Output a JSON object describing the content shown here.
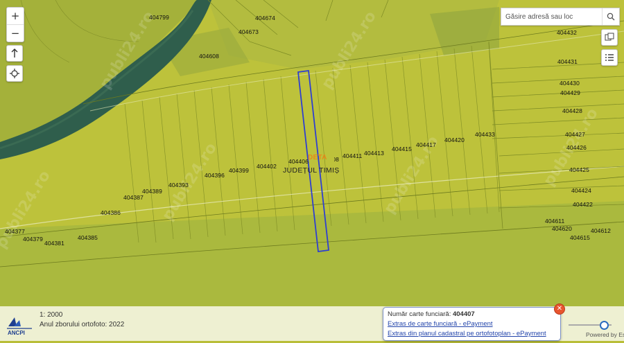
{
  "search": {
    "placeholder": "Găsire adresă sau loc"
  },
  "zoom": {
    "in_label": "+",
    "out_label": "−"
  },
  "scale": {
    "text": "1: 2000",
    "orthophoto_year": "Anul zborului ortofoto: 2022"
  },
  "logo": {
    "text": "ANCPI"
  },
  "popup": {
    "carte_label": "Număr carte funciară: ",
    "carte_number": "404407",
    "link1": "Extras de carte funciară - ePayment",
    "link2": "Extras din planul cadastral pe ortofotoplan - ePayment"
  },
  "attribution": "Powered by Esri",
  "map_labels": {
    "uat": "DETA",
    "county": "JUDEȚUL TIMIȘ",
    "parcels": [
      "404799",
      "404674",
      "404673",
      "404608",
      "404432",
      "404431",
      "404430",
      "404429",
      "404428",
      "404427",
      "404426",
      "404425",
      "404424",
      "404422",
      "404611",
      "404620",
      "404612",
      "404615",
      "404433",
      "404420",
      "404417",
      "404415",
      "404413",
      "404411",
      "404406",
      "404408",
      "404402",
      "404399",
      "404396",
      "404393",
      "404389",
      "404387",
      "404386",
      "404385",
      "404381",
      "404379",
      "404377"
    ]
  },
  "watermark": "publi24.ro",
  "colors": {
    "parcel_fill": "#b8be37",
    "river": "#2f5e4c",
    "highlight": "#2e3fd0",
    "popup_border": "#7d92c7"
  }
}
